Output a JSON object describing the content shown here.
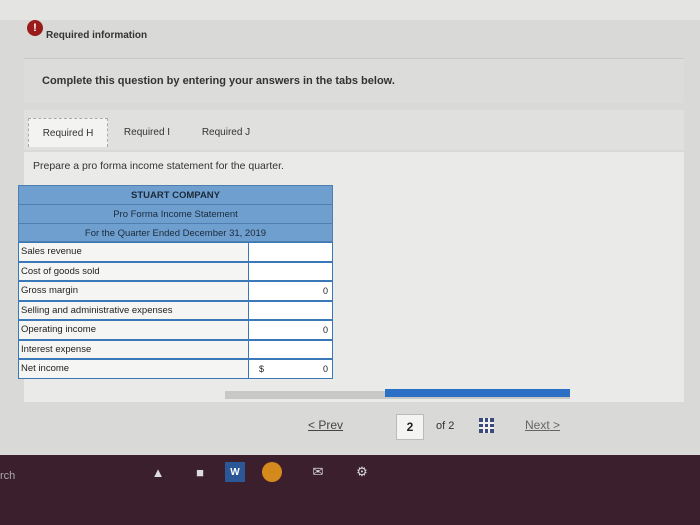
{
  "header": {
    "info_icon": "!",
    "required_info": "Required information"
  },
  "instructions": "Complete this question by entering your answers in the tabs below.",
  "tabs": [
    {
      "label": "Required H",
      "active": true
    },
    {
      "label": "Required I",
      "active": false
    },
    {
      "label": "Required J",
      "active": false
    }
  ],
  "prompt": "Prepare a pro forma income statement for the quarter.",
  "statement": {
    "company": "STUART COMPANY",
    "title": "Pro Forma Income Statement",
    "period": "For the Quarter Ended December 31, 2019",
    "rows": [
      {
        "label": "Sales revenue",
        "currency": "",
        "value": ""
      },
      {
        "label": "Cost of goods sold",
        "currency": "",
        "value": ""
      },
      {
        "label": "Gross margin",
        "currency": "",
        "value": "0"
      },
      {
        "label": "Selling and administrative expenses",
        "currency": "",
        "value": ""
      },
      {
        "label": "Operating income",
        "currency": "",
        "value": "0"
      },
      {
        "label": "Interest expense",
        "currency": "",
        "value": ""
      },
      {
        "label": "Net income",
        "currency": "$",
        "value": "0"
      }
    ]
  },
  "pagination": {
    "prev": "Prev",
    "current": "2",
    "of": "of 2",
    "next": "Next"
  },
  "taskbar": {
    "search_fragment": "rch",
    "word_label": "W"
  },
  "colors": {
    "header_blue": "#6f9fcf",
    "progress": "#2b70c4",
    "taskbar": "#3b1f2c",
    "info_icon": "#9a1b1b"
  }
}
